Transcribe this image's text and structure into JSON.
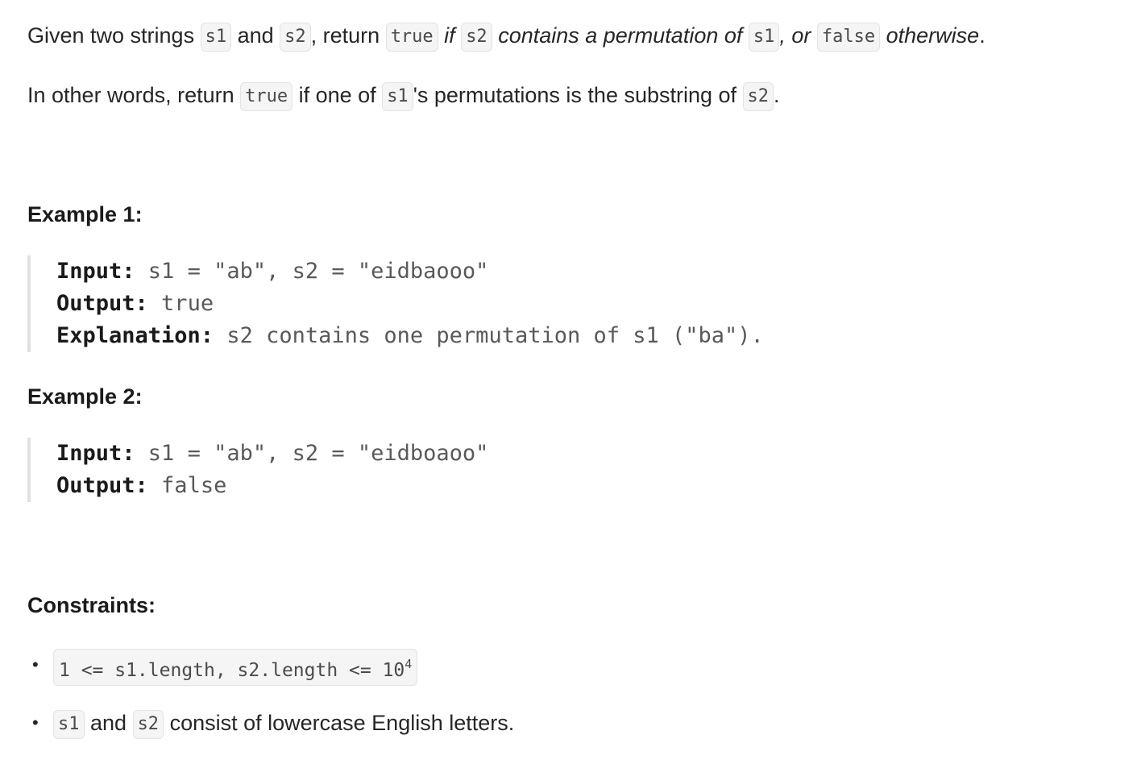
{
  "intro": {
    "p1": {
      "t1": "Given two strings ",
      "c1": "s1",
      "t2": " and ",
      "c2": "s2",
      "t3": ", return ",
      "c3": "true",
      "i1": " if ",
      "c4": "s2",
      "i2": " contains a permutation of ",
      "c5": "s1",
      "i3": ", or ",
      "c6": "false",
      "i4": " otherwise",
      "t4": "."
    },
    "p2": {
      "t1": "In other words, return ",
      "c1": "true",
      "t2": " if one of ",
      "c2": "s1",
      "t3": "'s permutations is the substring of ",
      "c3": "s2",
      "t4": "."
    }
  },
  "examples": [
    {
      "heading": "Example 1:",
      "input_label": "Input:",
      "input_value": " s1 = \"ab\", s2 = \"eidbaooo\"",
      "output_label": "Output:",
      "output_value": " true",
      "explanation_label": "Explanation:",
      "explanation_value": " s2 contains one permutation of s1 (\"ba\")."
    },
    {
      "heading": "Example 2:",
      "input_label": "Input:",
      "input_value": " s1 = \"ab\", s2 = \"eidboaoo\"",
      "output_label": "Output:",
      "output_value": " false"
    }
  ],
  "constraints": {
    "heading": "Constraints:",
    "bullet": "•",
    "item1": {
      "code": "1 <= s1.length, s2.length <= 10",
      "sup": "4"
    },
    "item2": {
      "c1": "s1",
      "t1": " and ",
      "c2": "s2",
      "t2": " consist of lowercase English letters."
    }
  }
}
